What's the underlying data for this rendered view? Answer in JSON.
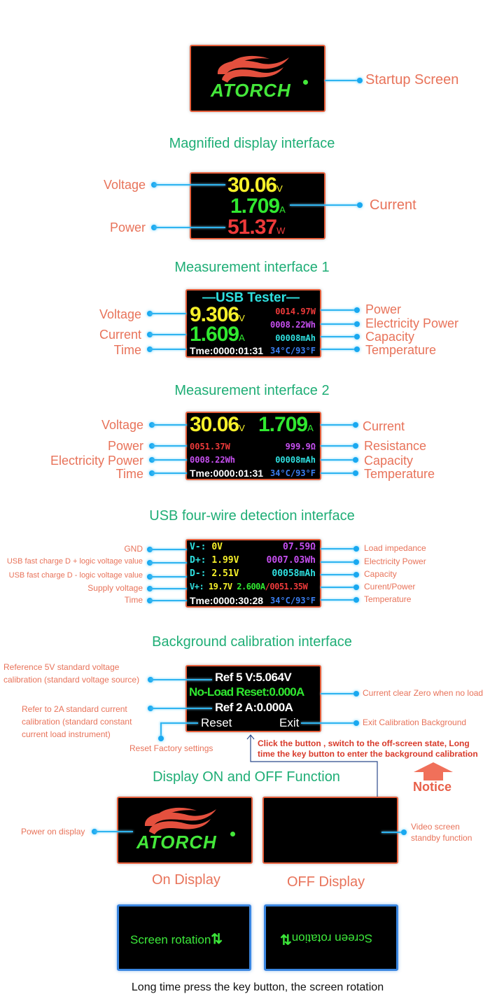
{
  "startup": {
    "label": "Startup Screen",
    "logo": "ATORCH"
  },
  "magnified": {
    "title": "Magnified display interface",
    "voltage": "30.06",
    "voltage_unit": "V",
    "current": "1.709",
    "current_unit": "A",
    "power": "51.37",
    "power_unit": "W",
    "labels": {
      "voltage": "Voltage",
      "current": "Current",
      "power": "Power"
    }
  },
  "measure1": {
    "title": "Measurement interface 1",
    "header": "—USB Tester—",
    "voltage": "9.306",
    "voltage_unit": "V",
    "current": "1.609",
    "current_unit": "A",
    "time": "Tme:0000:01:31",
    "power": "0014.97W",
    "energy": "0008.22Wh",
    "capacity": "00008mAh",
    "temperature": "34°C/93°F",
    "labels_left": [
      "Voltage",
      "Current",
      "Time"
    ],
    "labels_right": [
      "Power",
      "Electricity Power",
      "Capacity",
      "Temperature"
    ]
  },
  "measure2": {
    "title": "Measurement interface 2",
    "voltage": "30.06",
    "voltage_unit": "V",
    "current": "1.709",
    "current_unit": "A",
    "power": "0051.37W",
    "resistance": "999.9Ω",
    "energy": "0008.22Wh",
    "capacity": "00008mAh",
    "time": "Tme:0000:01:31",
    "temperature": "34°C/93°F",
    "labels_left": [
      "Voltage",
      "Power",
      "Electricity Power",
      "Time"
    ],
    "labels_right": [
      "Current",
      "Resistance",
      "Capacity",
      "Temperature"
    ]
  },
  "fourwire": {
    "title": "USB four-wire detection interface",
    "rows": [
      {
        "key": "V-:",
        "val": "0V",
        "right": "07.59Ω"
      },
      {
        "key": "D+:",
        "val": "1.99V",
        "right": "0007.03Wh"
      },
      {
        "key": "D-:",
        "val": "2.51V",
        "right": "00058mAh"
      },
      {
        "key": "V+:",
        "val": "19.7V",
        "mid": "2.600A",
        "right": "/0051.35W"
      }
    ],
    "time": "Tme:0000:30:28",
    "temperature": "34°C/93°F",
    "labels_left": [
      "GND",
      "USB fast charge D + logic voltage value",
      "USB fast charge D - logic voltage value",
      "Supply voltage",
      "Time"
    ],
    "labels_right": [
      "Load impedance",
      "Electricity Power",
      "Capacity",
      "Curent/Power",
      "Temperature"
    ]
  },
  "calibration": {
    "title": "Background calibration interface",
    "ref_voltage": "Ref 5 V:5.064V",
    "no_load": "No-Load Reset:0.000A",
    "ref_current": "Ref 2 A:0.000A",
    "reset": "Reset",
    "exit": "Exit",
    "label_voltage_1": "Reference 5V standard voltage",
    "label_voltage_2": "calibration (standard voltage source)",
    "label_current_1": "Refer to 2A standard current",
    "label_current_2": "calibration (standard constant",
    "label_current_3": "current load instrument)",
    "label_reset": "Reset Factory settings",
    "label_noload": "Current clear Zero when no load",
    "label_exit": "Exit Calibration Background",
    "notice_line1": "Click the button , switch to the off-screen state, Long",
    "notice_line2": "time the key button to enter the background calibration",
    "notice": "Notice"
  },
  "onoff": {
    "title": "Display ON and OFF Function",
    "on_label": "Power on display",
    "off_label_1": "Video screen",
    "off_label_2": "standby function",
    "on_caption": "On Display",
    "off_caption": "OFF Display",
    "logo": "ATORCH"
  },
  "rotation": {
    "text": "Screen rotation",
    "caption": "Long time press the key button, the screen rotation"
  }
}
